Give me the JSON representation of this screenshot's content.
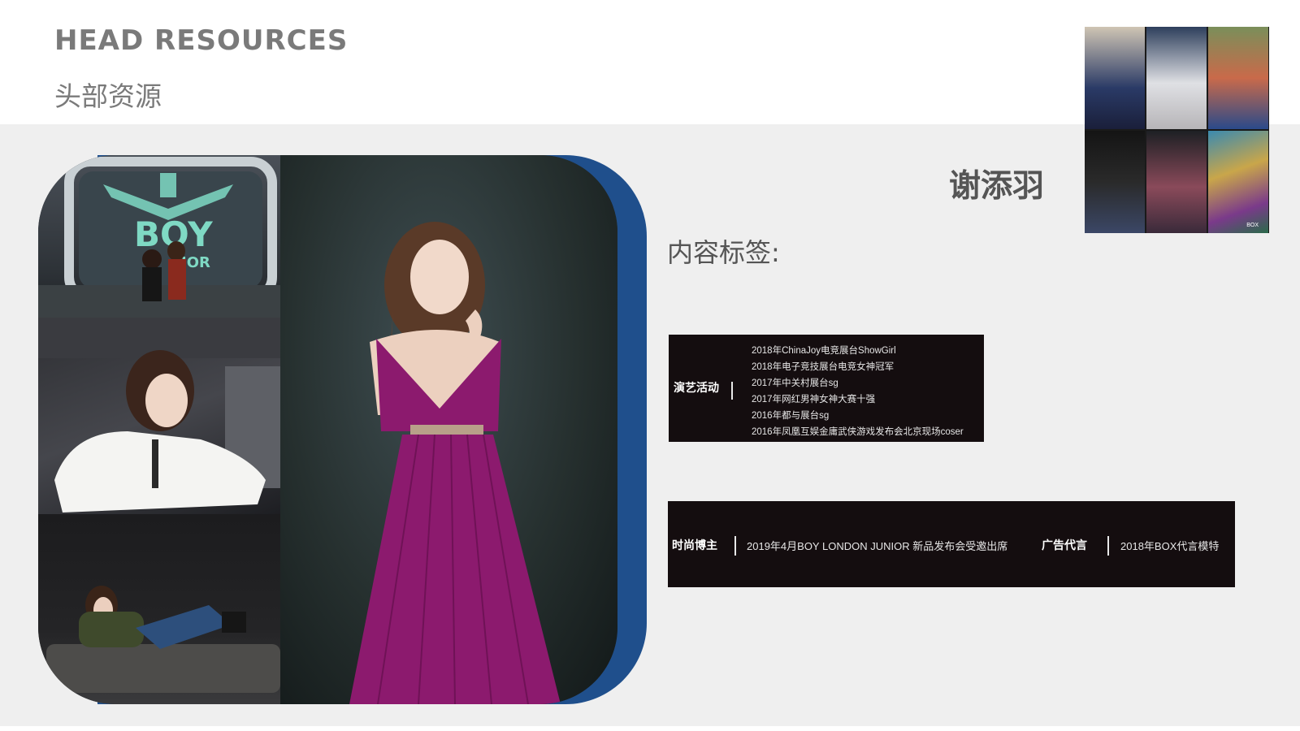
{
  "header": {
    "title_en": "HEAD RESOURCES",
    "title_zh": "头部资源"
  },
  "profile": {
    "name": "谢添羽",
    "tags_label": "内容标签:"
  },
  "stage_sign": {
    "logo_text": "BOY",
    "sub_text": "IOR"
  },
  "thumbnail_caption": "BOX",
  "performance": {
    "label": "演艺活动",
    "items": [
      "2018年ChinaJoy电竞展台ShowGirl",
      "2018年电子竞技展台电竞女神冠军",
      "2017年中关村展台sg",
      "2017年网红男神女神大赛十强",
      "2016年都与展台sg",
      "2016年凤凰互娱金庸武侠游戏发布会北京现场coser"
    ]
  },
  "fashion": {
    "label": "时尚博主",
    "text": "2019年4月BOY LONDON JUNIOR 新品发布会受邀出席",
    "ad_label": "广告代言",
    "ad_text": "2018年BOX代言模特"
  },
  "colors": {
    "accent_blue": "#1f4f8c",
    "panel_bg": "#140d0f",
    "dress_magenta": "#8c1a6e",
    "sign_teal": "#7fd9c4"
  }
}
